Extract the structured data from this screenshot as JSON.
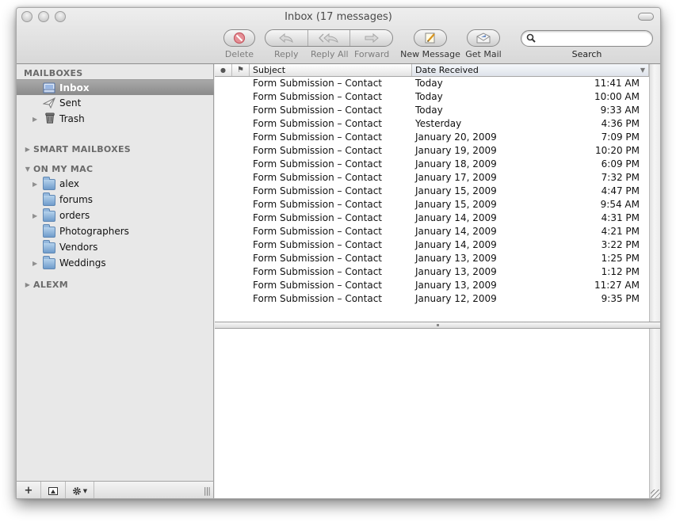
{
  "window": {
    "title": "Inbox (17 messages)"
  },
  "toolbar": {
    "delete_label": "Delete",
    "reply_label": "Reply",
    "reply_all_label": "Reply All",
    "forward_label": "Forward",
    "new_message_label": "New Message",
    "get_mail_label": "Get Mail",
    "search_label": "Search",
    "search_value": "",
    "search_placeholder": ""
  },
  "sidebar": {
    "mailboxes_header": "MAILBOXES",
    "mailboxes": [
      {
        "label": "Inbox",
        "icon": "inbox-tray-icon",
        "selected": true,
        "expandable": false
      },
      {
        "label": "Sent",
        "icon": "paper-plane-icon",
        "selected": false,
        "expandable": false
      },
      {
        "label": "Trash",
        "icon": "trash-can-icon",
        "selected": false,
        "expandable": true
      }
    ],
    "smart_mailboxes_header": "SMART MAILBOXES",
    "on_my_mac_header": "ON MY MAC",
    "on_my_mac": [
      {
        "label": "alex",
        "expandable": true
      },
      {
        "label": "forums",
        "expandable": false
      },
      {
        "label": "orders",
        "expandable": true
      },
      {
        "label": "Photographers",
        "expandable": false
      },
      {
        "label": "Vendors",
        "expandable": false
      },
      {
        "label": "Weddings",
        "expandable": true
      }
    ],
    "account_header": "ALEXM",
    "bottom": {
      "add_icon": "+",
      "grip": "|||"
    }
  },
  "message_list": {
    "columns": {
      "unread": "●",
      "flag": "⚑",
      "subject": "Subject",
      "date_received": "Date Received",
      "sort_indicator": "▼"
    },
    "rows": [
      {
        "subject": "Form Submission – Contact",
        "date": "Today",
        "time": "11:41 AM"
      },
      {
        "subject": "Form Submission – Contact",
        "date": "Today",
        "time": "10:00 AM"
      },
      {
        "subject": "Form Submission – Contact",
        "date": "Today",
        "time": "9:33 AM"
      },
      {
        "subject": "Form Submission – Contact",
        "date": "Yesterday",
        "time": "4:36 PM"
      },
      {
        "subject": "Form Submission – Contact",
        "date": "January 20, 2009",
        "time": "7:09 PM"
      },
      {
        "subject": "Form Submission – Contact",
        "date": "January 19, 2009",
        "time": "10:20 PM"
      },
      {
        "subject": "Form Submission – Contact",
        "date": "January 18, 2009",
        "time": "6:09 PM"
      },
      {
        "subject": "Form Submission – Contact",
        "date": "January 17, 2009",
        "time": "7:32 PM"
      },
      {
        "subject": "Form Submission – Contact",
        "date": "January 15, 2009",
        "time": "4:47 PM"
      },
      {
        "subject": "Form Submission – Contact",
        "date": "January 15, 2009",
        "time": "9:54 AM"
      },
      {
        "subject": "Form Submission – Contact",
        "date": "January 14, 2009",
        "time": "4:31 PM"
      },
      {
        "subject": "Form Submission – Contact",
        "date": "January 14, 2009",
        "time": "4:21 PM"
      },
      {
        "subject": "Form Submission – Contact",
        "date": "January 14, 2009",
        "time": "3:22 PM"
      },
      {
        "subject": "Form Submission – Contact",
        "date": "January 13, 2009",
        "time": "1:25 PM"
      },
      {
        "subject": "Form Submission – Contact",
        "date": "January 13, 2009",
        "time": "1:12 PM"
      },
      {
        "subject": "Form Submission – Contact",
        "date": "January 13, 2009",
        "time": "11:27 AM"
      },
      {
        "subject": "Form Submission – Contact",
        "date": "January 12, 2009",
        "time": "9:35 PM"
      }
    ]
  }
}
